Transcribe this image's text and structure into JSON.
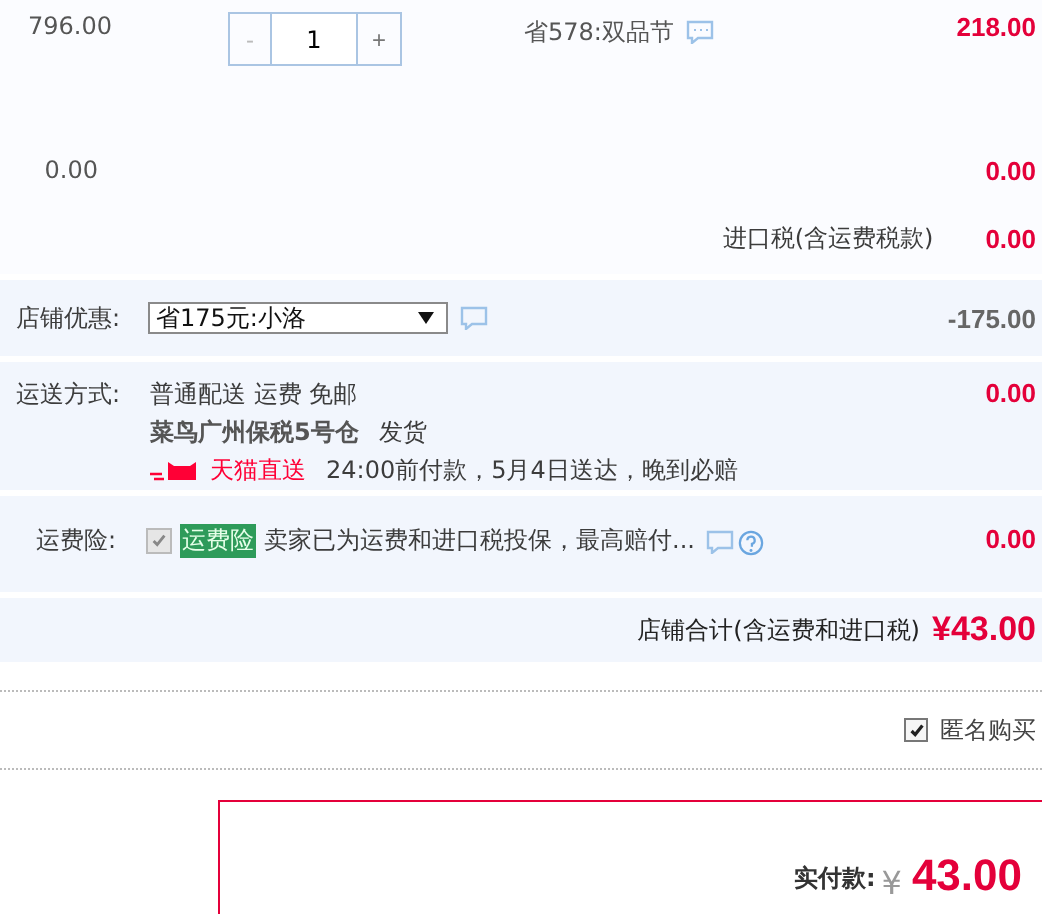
{
  "item": {
    "unit_price": "796.00",
    "decrease": "-",
    "quantity": "1",
    "increase": "+",
    "promo": "省578:双品节",
    "subtotal": "218.00"
  },
  "extra_row": {
    "price": "0.00",
    "amount": "0.00"
  },
  "import_tax": {
    "label": "进口税(含运费税款)",
    "amount": "0.00"
  },
  "store_discount": {
    "label": "店铺优惠:",
    "value": "省175元:小洛",
    "amount": "-175.00"
  },
  "shipping": {
    "label": "运送方式:",
    "method": "普通配送 运费 免邮",
    "warehouse": "菜鸟广州保税5号仓",
    "dispatch": "发货",
    "badge": "天猫直送",
    "promise": "24:00前付款，5月4日送达，晚到必赔",
    "amount": "0.00"
  },
  "insurance": {
    "label": "运费险:",
    "checked": true,
    "disabled": true,
    "tag": "运费险",
    "text": "卖家已为运费和进口税投保，最高赔付...",
    "amount": "0.00"
  },
  "store_total": {
    "label": "店铺合计(含运费和进口税)",
    "amount": "¥43.00"
  },
  "anonymous": {
    "label": "匿名购买",
    "checked": true
  },
  "payment": {
    "label": "实付款:",
    "currency": "¥",
    "amount": "43.00"
  }
}
